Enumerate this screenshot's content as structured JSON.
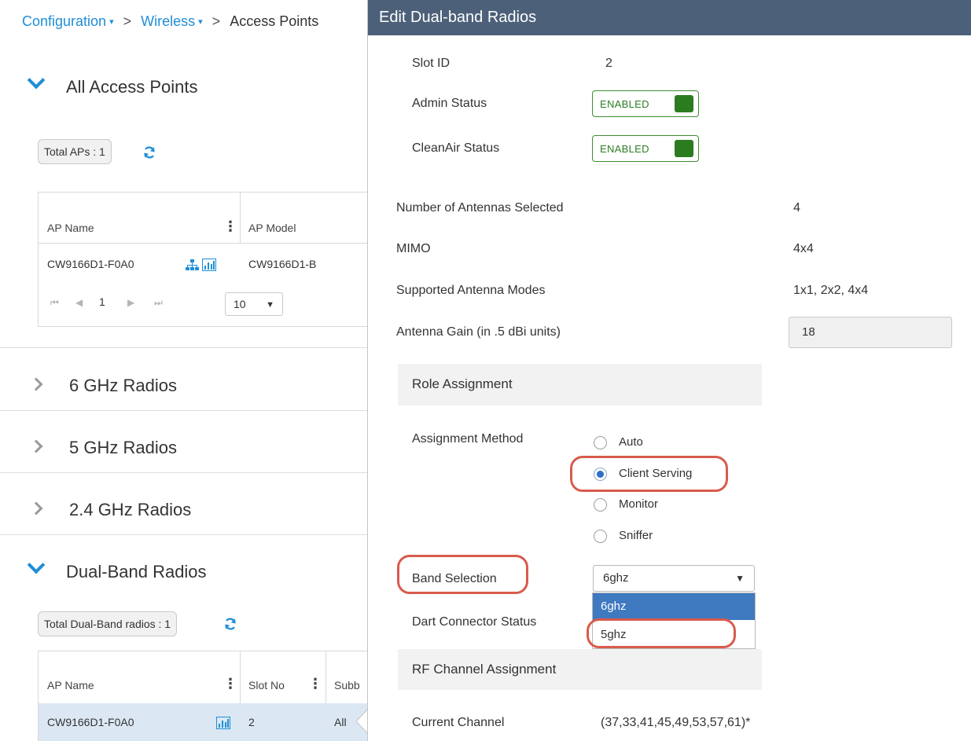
{
  "breadcrumb": {
    "configuration": "Configuration",
    "wireless": "Wireless",
    "access_points": "Access Points",
    "caret": "▾",
    "separator": ">"
  },
  "all_aps": {
    "title": "All Access Points",
    "total_label": "Total APs : 1",
    "columns": [
      "AP Name",
      "AP Model"
    ],
    "rows": [
      {
        "ap_name": "CW9166D1-F0A0",
        "ap_model": "CW9166D1-B"
      }
    ],
    "pagination": {
      "page": "1",
      "page_size": "10",
      "first": "⏮",
      "prev": "◀",
      "next": "▶",
      "last": "⏭"
    }
  },
  "sections": {
    "six_ghz": "6 GHz Radios",
    "five_ghz": "5 GHz Radios",
    "two_four_ghz": "2.4 GHz Radios"
  },
  "dual_band": {
    "title": "Dual-Band Radios",
    "total_label": "Total Dual-Band radios : 1",
    "columns": [
      "AP Name",
      "Slot No",
      "Subb"
    ],
    "rows": [
      {
        "ap_name": "CW9166D1-F0A0",
        "slot_no": "2",
        "subband": "All"
      }
    ]
  },
  "modal": {
    "title": "Edit Dual-band Radios",
    "slot_id_label": "Slot ID",
    "slot_id_value": "2",
    "admin_status_label": "Admin Status",
    "admin_status_value": "ENABLED",
    "cleanair_label": "CleanAir Status",
    "cleanair_value": "ENABLED",
    "antennas_label": "Number of Antennas Selected",
    "antennas_value": "4",
    "mimo_label": "MIMO",
    "mimo_value": "4x4",
    "antenna_modes_label": "Supported Antenna Modes",
    "antenna_modes_value": "1x1, 2x2, 4x4",
    "gain_label": "Antenna Gain (in .5 dBi units)",
    "gain_value": "18",
    "role_assignment_title": "Role Assignment",
    "assignment_method_label": "Assignment Method",
    "assignment_options": [
      "Auto",
      "Client Serving",
      "Monitor",
      "Sniffer"
    ],
    "assignment_selected": "Client Serving",
    "band_selection_label": "Band Selection",
    "band_selected": "6ghz",
    "band_options": [
      "6ghz",
      "5ghz"
    ],
    "dart_label": "Dart Connector Status",
    "rf_title": "RF Channel Assignment",
    "current_channel_label": "Current Channel",
    "current_channel_value": "(37,33,41,45,49,53,57,61)*"
  },
  "colors": {
    "modal_header": "#4c6079",
    "link": "#1f8ed6",
    "enabled_green": "#2b7c1f",
    "highlight_ring": "#d85b4c",
    "selected_row": "#dbe8f3"
  }
}
